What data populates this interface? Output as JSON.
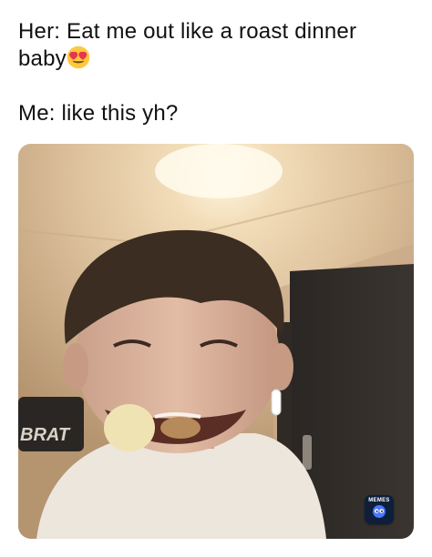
{
  "caption": {
    "line1": "Her: Eat me out like a roast dinner",
    "line2": "baby",
    "line2_emoji": "heart-eyes-emoji",
    "line3": "Me: like this yh?"
  },
  "photo": {
    "jumper_text": "BRAT"
  },
  "badge": {
    "label": "MEMES",
    "icon": "meme-app-face-icon"
  },
  "colors": {
    "caption_text": "#111111",
    "badge_bg": "#0d1f3a",
    "emoji_face": "#ffc83d",
    "emoji_hearts": "#e8344e"
  }
}
